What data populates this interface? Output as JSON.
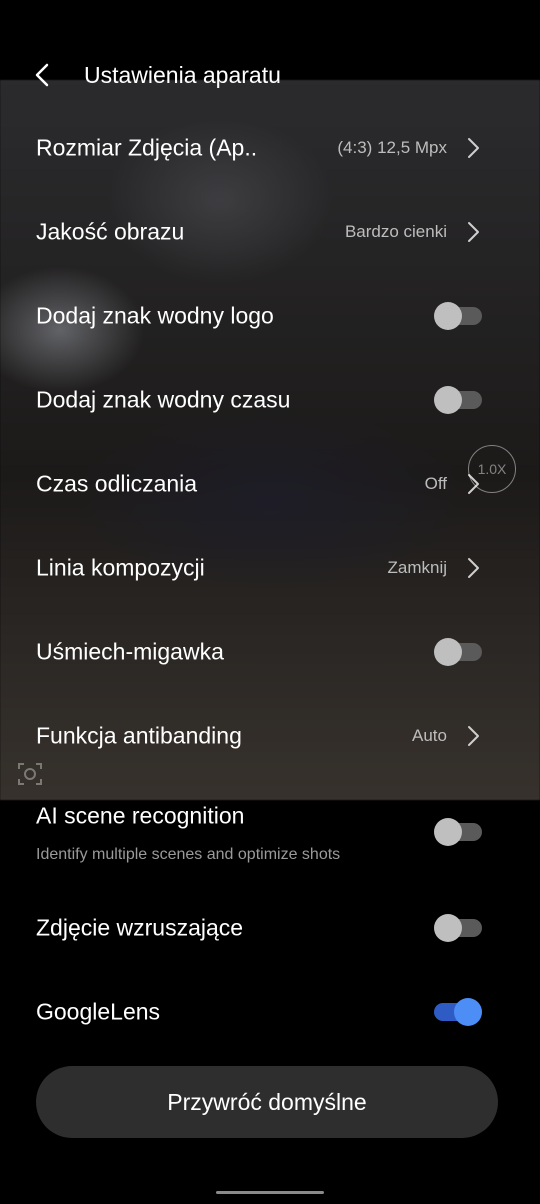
{
  "header": {
    "title": "Ustawienia aparatu"
  },
  "rows": [
    {
      "label": "Rozmiar Zdjęcia (Ap..",
      "value": "(4:3) 12,5 Mpx"
    },
    {
      "label": "Jakość obrazu",
      "value": "Bardzo cienki"
    },
    {
      "label": "Dodaj znak wodny logo",
      "toggle": false
    },
    {
      "label": "Dodaj znak wodny czasu",
      "toggle": false
    },
    {
      "label": "Czas odliczania",
      "value": "Off"
    },
    {
      "label": "Linia kompozycji",
      "value": "Zamknij"
    },
    {
      "label": "Uśmiech-migawka",
      "toggle": false
    },
    {
      "label": "Funkcja antibanding",
      "value": "Auto"
    },
    {
      "label": "AI scene recognition",
      "sub": "Identify multiple scenes and optimize shots",
      "toggle": false
    },
    {
      "label": "Zdjęcie wzruszające",
      "toggle": false
    },
    {
      "label": "GoogleLens",
      "toggle": true
    }
  ],
  "zoom": "1.0X",
  "reset_label": "Przywróć domyślne",
  "colors": {
    "accent": "#4c8df6",
    "toggle_off": "#bfbfbf",
    "background": "#000000"
  },
  "icons": [
    "back-arrow-icon",
    "chevron-right-icon",
    "lens-frame-icon"
  ]
}
